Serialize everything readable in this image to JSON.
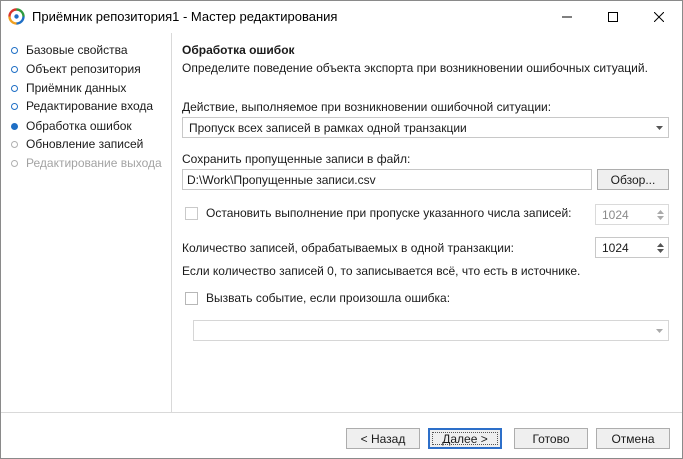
{
  "window": {
    "title": "Приёмник репозитория1 - Мастер редактирования"
  },
  "steps": [
    {
      "label": "Базовые свойства",
      "state": "done"
    },
    {
      "label": "Объект репозитория",
      "state": "done"
    },
    {
      "label": "Приёмник данных",
      "state": "done"
    },
    {
      "label": "Редактирование входа",
      "state": "done"
    },
    {
      "label": "Обработка ошибок",
      "state": "current"
    },
    {
      "label": "Обновление записей",
      "state": "pending"
    },
    {
      "label": "Редактирование выхода",
      "state": "disabled"
    }
  ],
  "main": {
    "section_title": "Обработка ошибок",
    "section_desc": "Определите поведение объекта экспорта при возникновении ошибочных ситуаций.",
    "action_label": "Действие, выполняемое при возникновении ошибочной ситуации:",
    "action_value": "Пропуск всех записей в рамках одной транзакции",
    "save_label": "Сохранить пропущенные записи в файл:",
    "save_path": "D:\\Work\\Пропущенные записи.csv",
    "browse_label": "Обзор...",
    "stop_label": "Остановить выполнение при пропуске указанного числа записей:",
    "stop_value": "1024",
    "count_label": "Количество записей, обрабатываемых в одной транзакции:",
    "count_value": "1024",
    "count_hint": "Если количество записей 0, то записывается всё, что есть в источнике.",
    "event_label": "Вызвать событие, если произошла ошибка:",
    "event_value": ""
  },
  "footer": {
    "back_label": "< Назад",
    "next_label": "Далее >",
    "done_label": "Готово",
    "cancel_label": "Отмена"
  },
  "colors": {
    "accent": "#1f6fc5",
    "disabled_text": "#a3a3a3"
  },
  "icons": {
    "app": "wizard-app-icon",
    "minimize": "minimize-icon",
    "maximize": "maximize-icon",
    "close": "close-icon",
    "dropdown": "chevron-down-icon",
    "spin": "spin-arrows-icon"
  }
}
